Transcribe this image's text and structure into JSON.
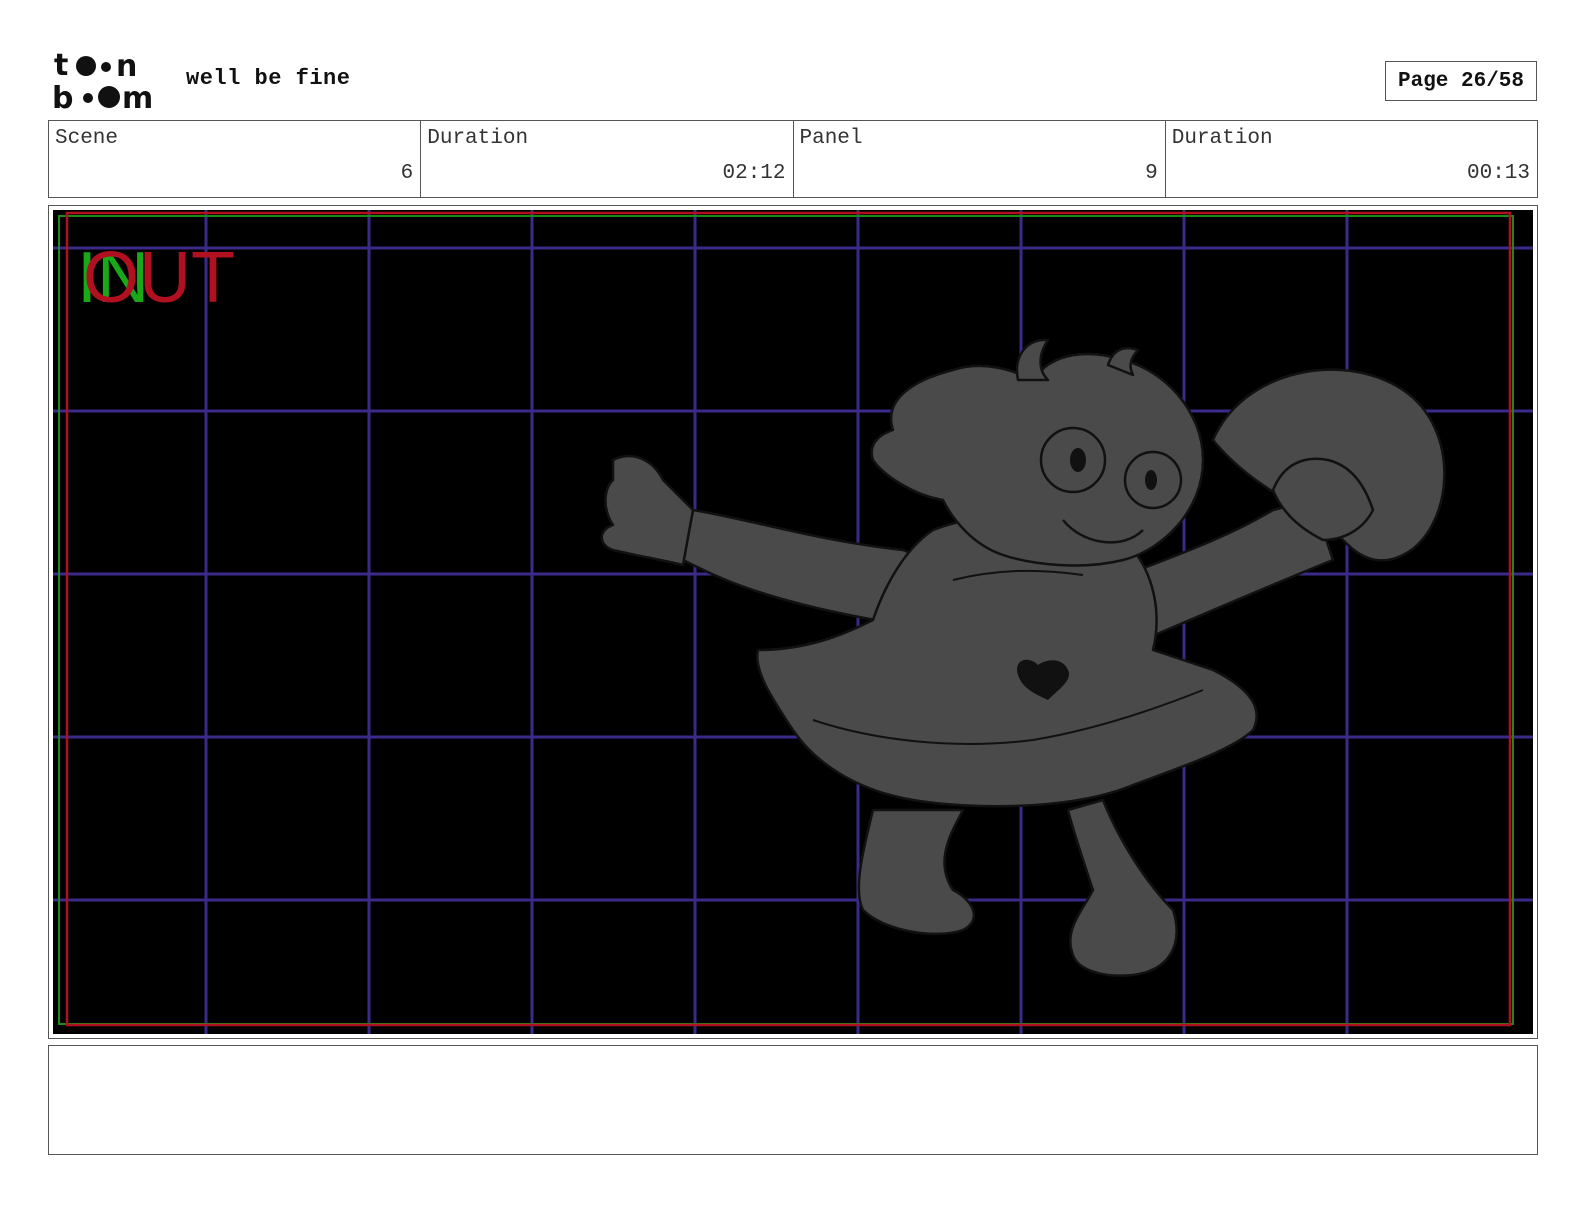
{
  "header": {
    "logo_text_top": "toon",
    "logo_text_bottom": "boom",
    "project_title": "well be fine",
    "page_label": "Page 26/58"
  },
  "info": {
    "scene_label": "Scene",
    "scene_value": "6",
    "scene_duration_label": "Duration",
    "scene_duration_value": "02:12",
    "panel_label": "Panel",
    "panel_value": "9",
    "panel_duration_label": "Duration",
    "panel_duration_value": "00:13"
  },
  "panel": {
    "in_label": "IN",
    "out_label": "OUT",
    "colors": {
      "background": "#000000",
      "grid": "#3b2a8a",
      "safe_frame": "#b01020",
      "action_frame": "#1a8a1a",
      "figure_fill": "#4a4a4a",
      "figure_line": "#111111"
    }
  },
  "notes": {
    "text": ""
  }
}
